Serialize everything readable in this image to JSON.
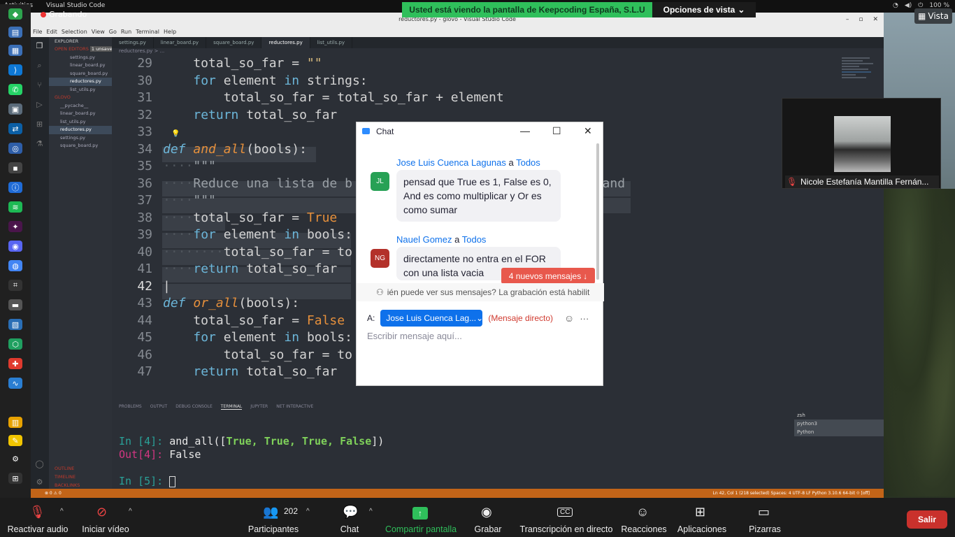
{
  "gnome": {
    "activities": "Activities",
    "app": "Visual Studio Code",
    "battery": "100 %"
  },
  "zoom_banner": {
    "text": "Usted está viendo la pantalla de Keepcoding España, S.L.U",
    "view_options": "Opciones de vista",
    "vista": "Vista",
    "recording": "Grabando"
  },
  "vscode": {
    "title": "reductores.py - glovo - Visual Studio Code",
    "menu": [
      "File",
      "Edit",
      "Selection",
      "View",
      "Go",
      "Run",
      "Terminal",
      "Help"
    ],
    "explorer": "EXPLORER",
    "open_editors": "OPEN EDITORS",
    "unsaved": "1 unsaved",
    "open_files": [
      "settings.py",
      "linear_board.py",
      "square_board.py",
      "reductores.py",
      "list_utils.py"
    ],
    "project": "GLOVO",
    "project_files": [
      "__pycache__",
      "linear_board.py",
      "list_utils.py",
      "reductores.py",
      "settings.py",
      "square_board.py"
    ],
    "outline": "OUTLINE",
    "timeline": "TIMELINE",
    "backlinks": "BACKLINKS",
    "tabs": [
      "settings.py",
      "linear_board.py",
      "square_board.py",
      "reductores.py",
      "list_utils.py"
    ],
    "breadcrumb": "reductores.py > ...",
    "line_numbers": [
      "29",
      "30",
      "31",
      "32",
      "33",
      "34",
      "35",
      "36",
      "37",
      "38",
      "39",
      "40",
      "41",
      "42",
      "43",
      "44",
      "45",
      "46",
      "47"
    ],
    "panel_tabs": [
      "PROBLEMS",
      "OUTPUT",
      "DEBUG CONSOLE",
      "TERMINAL",
      "JUPYTER",
      "NET INTERACTIVE"
    ],
    "terminal": {
      "in4_prompt": "In [4]:",
      "in4_call": "and_all(",
      "in4_args": "True, True, True, False",
      "in4_close": "])",
      "out4_prompt": "Out[4]:",
      "out4_value": "False",
      "in5_prompt": "In [5]:"
    },
    "terminal_list": [
      "zsh",
      "python3",
      "Python"
    ],
    "status": {
      "left": "⊗ 0 ⚠ 0",
      "right": "Ln 42, Col 1 (218 selected)   Spaces: 4   UTF-8   LF   Python   3.10.6 64-bit   ⟐ [off]"
    }
  },
  "video_tile": {
    "name": "Nicole Estefanía Mantilla Fernán..."
  },
  "chat": {
    "title": "Chat",
    "messages": [
      {
        "author": "Jose Luis Cuenca Lagunas",
        "to": "a",
        "recipient": "Todos",
        "initials": "JL",
        "color": "#27a155",
        "lines": [
          "pensad que True es 1, False es 0,",
          "And es como multiplicar y Or es",
          "como sumar"
        ]
      },
      {
        "author": "Nauel Gomez",
        "to": "a",
        "recipient": "Todos",
        "initials": "NG",
        "color": "#b3312a",
        "lines": [
          "directamente no entra en el FOR",
          "con una lista vacia"
        ]
      }
    ],
    "new_messages": "4 nuevos mensajes",
    "info": "ién puede ver sus mensajes? La grabación está habilit",
    "to_label": "A:",
    "to_value": "Jose Luis Cuenca Lag...",
    "dm_label": "(Mensaje directo)",
    "placeholder": "Escribir mensaje aquí..."
  },
  "toolbar": {
    "audio": "Reactivar audio",
    "video": "Iniciar vídeo",
    "participants": "Participantes",
    "participants_count": "202",
    "chat": "Chat",
    "share": "Compartir pantalla",
    "record": "Grabar",
    "transcript": "Transcripción en directo",
    "reactions": "Reacciones",
    "apps": "Aplicaciones",
    "whiteboards": "Pizarras",
    "leave": "Salir",
    "cc": "CC"
  }
}
